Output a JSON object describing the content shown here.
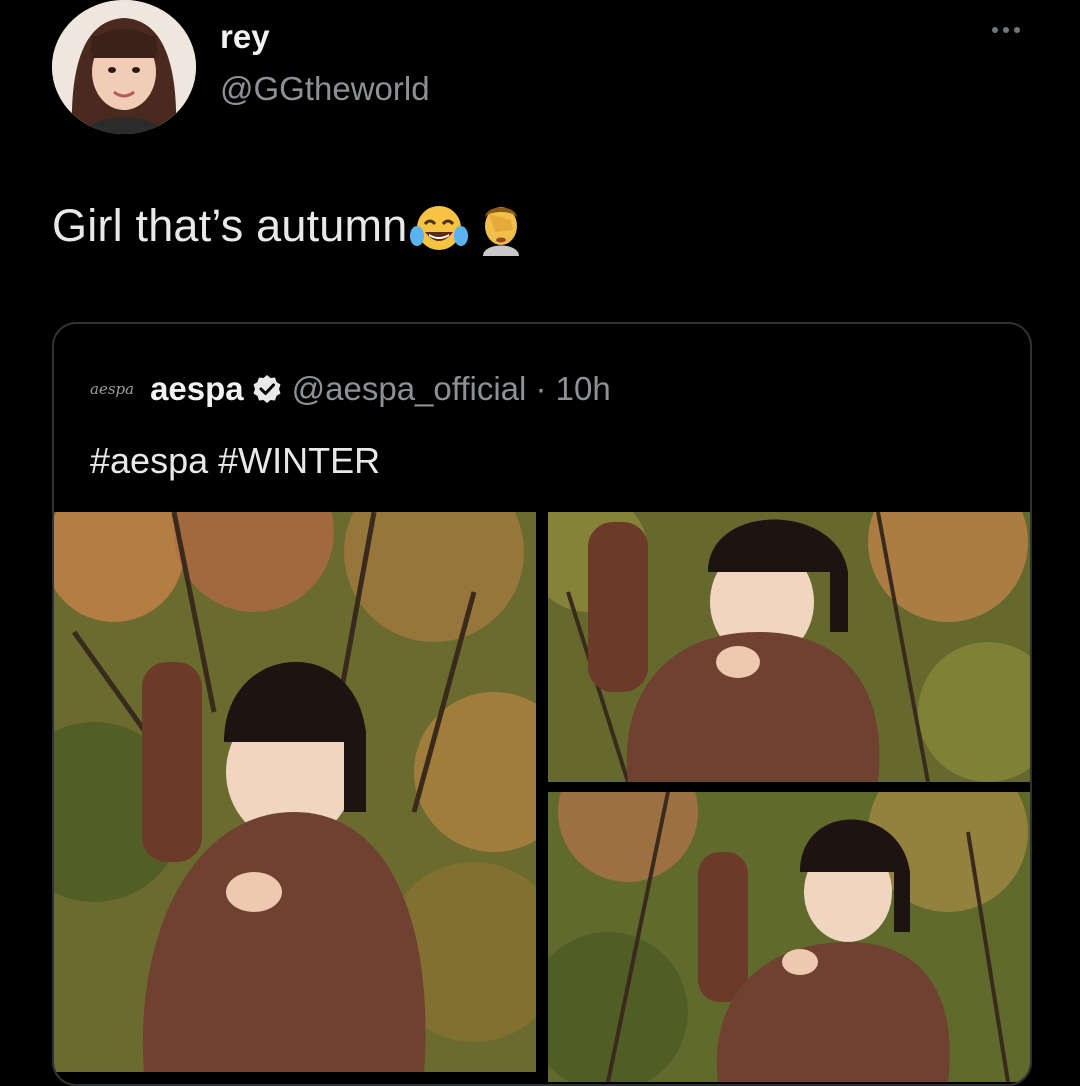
{
  "tweet": {
    "author": {
      "name": "rey",
      "handle": "@GGtheworld",
      "avatar_icon": "profile-photo"
    },
    "text": "Girl that’s autumn",
    "emojis": [
      "face-with-tears-of-joy-icon",
      "person-facepalming-icon"
    ],
    "more_icon": "more-options-icon"
  },
  "quoted": {
    "logo_text": "aespa",
    "name": "aespa",
    "verified": true,
    "handle_time": "@aespa_official · 10h",
    "text": "#aespa #WINTER",
    "photos": [
      "photo-1",
      "photo-2",
      "photo-3"
    ]
  },
  "colors": {
    "background": "#000000",
    "border": "#2f3336",
    "secondary_text": "#8d9195",
    "verified_badge": "#e7e9ea"
  }
}
